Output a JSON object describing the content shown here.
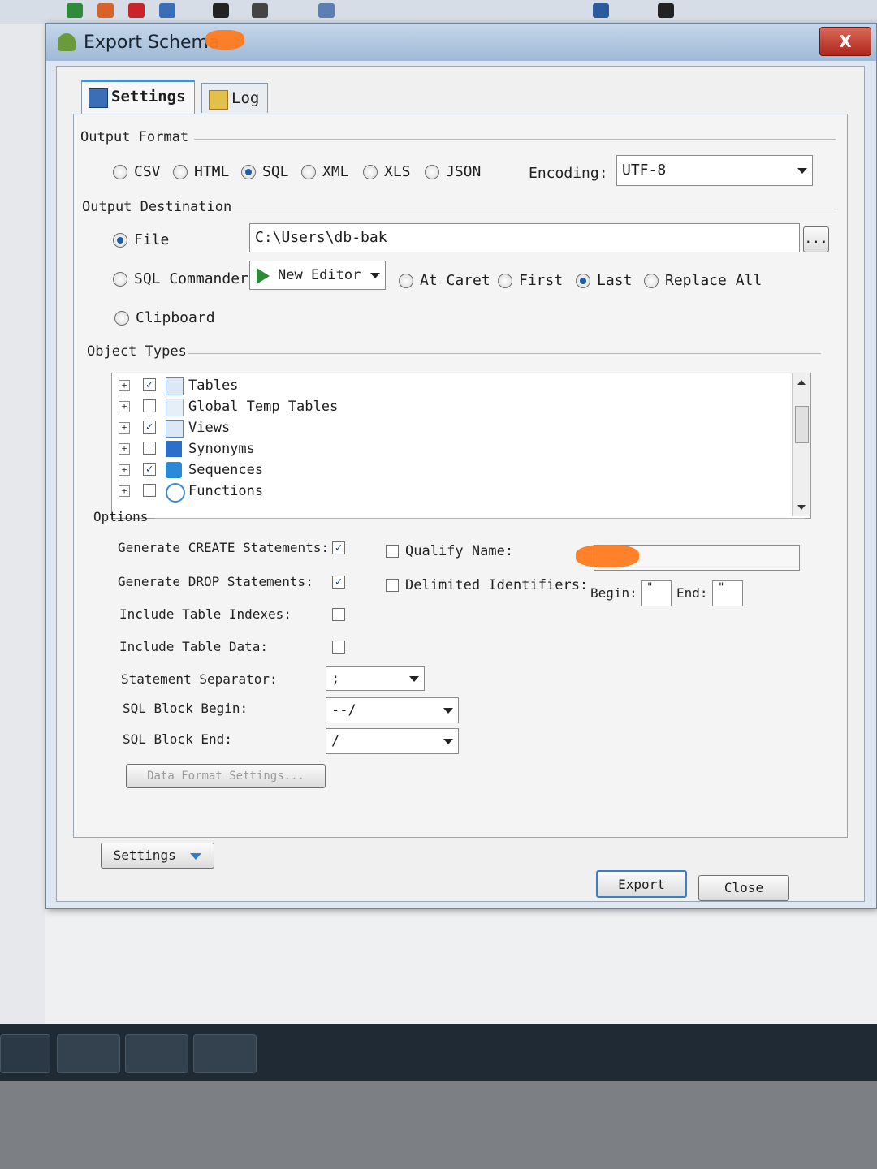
{
  "window": {
    "title": "Export Schema",
    "close_label": "X"
  },
  "tabs": [
    {
      "label": "Settings",
      "active": true,
      "icon": "settings-grid-icon"
    },
    {
      "label": "Log",
      "active": false,
      "icon": "log-document-icon"
    }
  ],
  "output_format": {
    "label": "Output Format",
    "options": [
      "CSV",
      "HTML",
      "SQL",
      "XML",
      "XLS",
      "JSON"
    ],
    "selected": "SQL",
    "encoding_label": "Encoding:",
    "encoding_value": "UTF-8"
  },
  "output_destination": {
    "label": "Output Destination",
    "file_label": "File",
    "file_path": "C:\\Users\\db-bak",
    "browse_label": "...",
    "sql_commander_label": "SQL Commander",
    "editor_value": "New Editor",
    "caret_options": [
      "At Caret",
      "First",
      "Last",
      "Replace All"
    ],
    "caret_selected": "Last",
    "clipboard_label": "Clipboard",
    "selected": "File"
  },
  "object_types": {
    "label": "Object Types",
    "items": [
      {
        "label": "Tables",
        "checked": true
      },
      {
        "label": "Global Temp Tables",
        "checked": false
      },
      {
        "label": "Views",
        "checked": true
      },
      {
        "label": "Synonyms",
        "checked": false
      },
      {
        "label": "Sequences",
        "checked": true
      },
      {
        "label": "Functions",
        "checked": false
      }
    ]
  },
  "options": {
    "label": "Options",
    "generate_create_label": "Generate CREATE Statements:",
    "generate_create": true,
    "generate_drop_label": "Generate DROP Statements:",
    "generate_drop": true,
    "include_indexes_label": "Include Table Indexes:",
    "include_indexes": false,
    "include_data_label": "Include Table Data:",
    "include_data": false,
    "statement_separator_label": "Statement Separator:",
    "statement_separator_value": ";",
    "sql_block_begin_label": "SQL Block Begin:",
    "sql_block_begin_value": "--/",
    "sql_block_end_label": "SQL Block End:",
    "sql_block_end_value": "/",
    "qualify_name_label": "Qualify Name:",
    "qualify_name": false,
    "delimited_label": "Delimited Identifiers:",
    "delimited": false,
    "begin_label": "Begin:",
    "begin_value": "\"",
    "end_label": "End:",
    "end_value": "\"",
    "data_format_label": "Data Format Settings..."
  },
  "footer": {
    "settings_label": "Settings",
    "export_label": "Export",
    "close_label": "Close"
  },
  "colors": {
    "accent": "#1c5fa8",
    "title_bar": "#9fb9d6",
    "close_button": "#b0261a",
    "redaction": "#ff7a1f"
  }
}
